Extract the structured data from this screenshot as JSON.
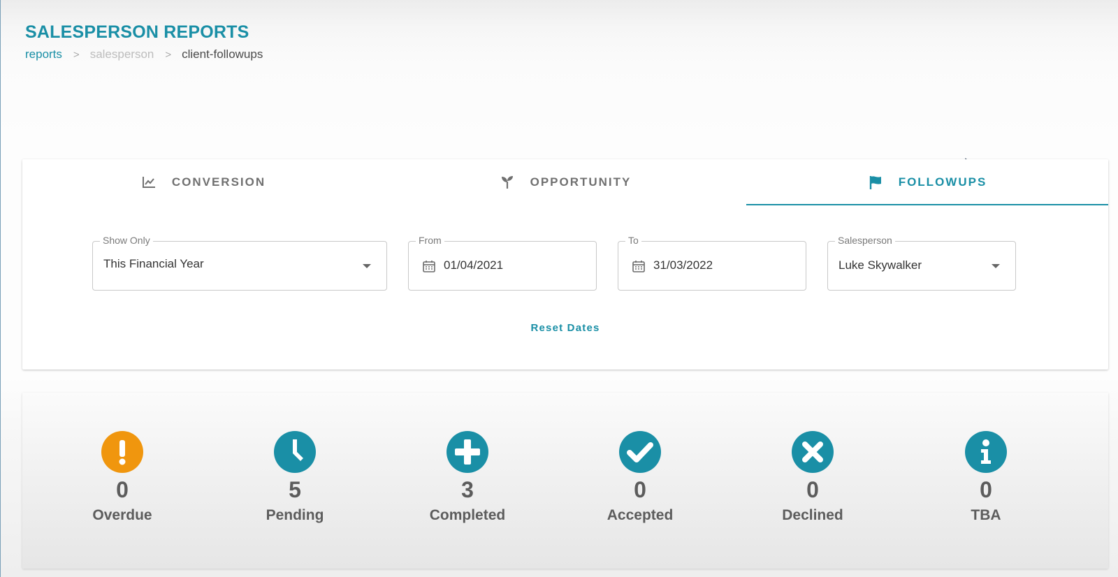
{
  "header": {
    "title": "SALESPERSON REPORTS",
    "breadcrumb": {
      "first": "reports",
      "second": "salesperson",
      "third": "client-followups",
      "separator": ">"
    }
  },
  "tabs": [
    {
      "label": "CONVERSION",
      "icon": "chart-line-icon",
      "active": false
    },
    {
      "label": "OPPORTUNITY",
      "icon": "sprout-icon",
      "active": false
    },
    {
      "label": "FOLLOWUPS",
      "icon": "flag-icon",
      "active": true
    }
  ],
  "filters": {
    "show_only": {
      "label": "Show Only",
      "value": "This Financial Year"
    },
    "from": {
      "label": "From",
      "value": "01/04/2021"
    },
    "to": {
      "label": "To",
      "value": "31/03/2022"
    },
    "salesperson": {
      "label": "Salesperson",
      "value": "Luke Skywalker"
    },
    "reset_label": "Reset Dates"
  },
  "stats": [
    {
      "label": "Overdue",
      "count": "0",
      "icon": "exclamation-icon",
      "color": "#f0960e"
    },
    {
      "label": "Pending",
      "count": "5",
      "icon": "clock-icon",
      "color": "#1a8fa6"
    },
    {
      "label": "Completed",
      "count": "3",
      "icon": "plus-icon",
      "color": "#1a8fa6"
    },
    {
      "label": "Accepted",
      "count": "0",
      "icon": "check-icon",
      "color": "#1a8fa6"
    },
    {
      "label": "Declined",
      "count": "0",
      "icon": "times-icon",
      "color": "#1a8fa6"
    },
    {
      "label": "TBA",
      "count": "0",
      "icon": "info-icon",
      "color": "#1a8fa6"
    }
  ],
  "colors": {
    "accent": "#1a8fa6",
    "warning": "#f0960e"
  }
}
